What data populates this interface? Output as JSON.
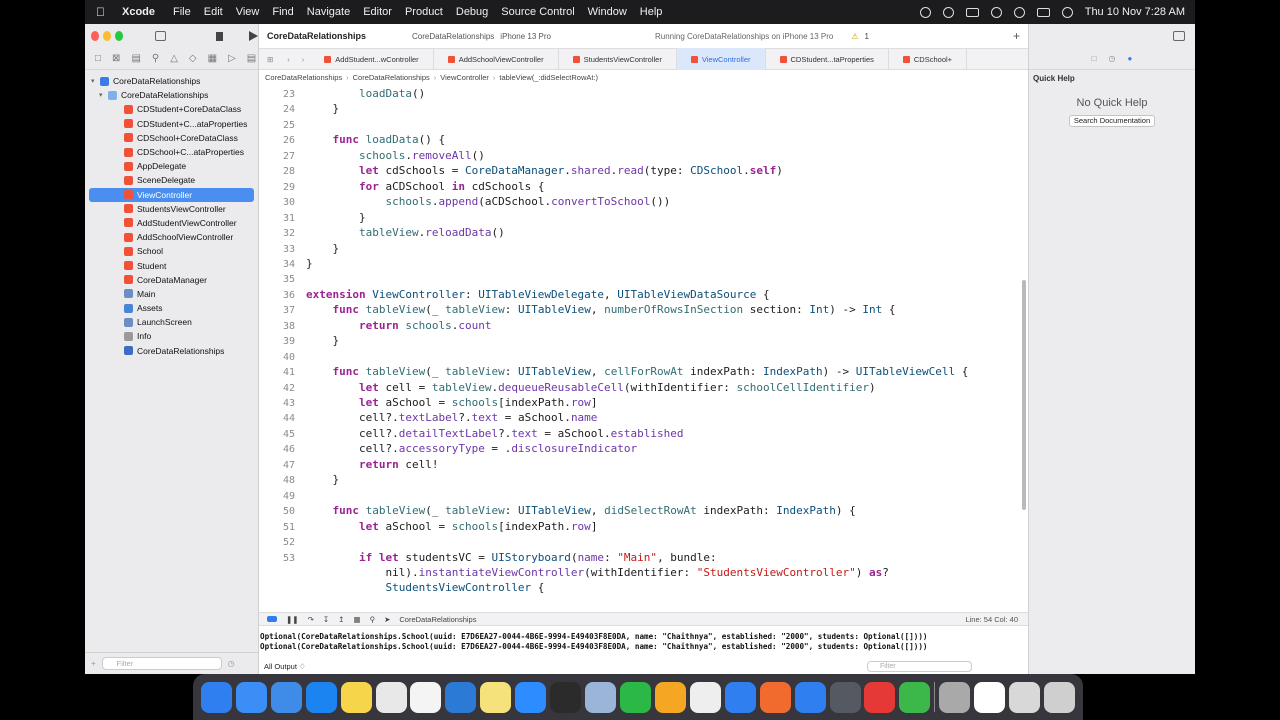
{
  "menubar": {
    "app_name": "Xcode",
    "menus": [
      "File",
      "Edit",
      "View",
      "Find",
      "Navigate",
      "Editor",
      "Product",
      "Debug",
      "Source Control",
      "Window",
      "Help"
    ],
    "datetime": "Thu 10 Nov  7:28 AM"
  },
  "toolbar": {
    "project_title": "CoreDataRelationships",
    "scheme": "CoreDataRelationships",
    "device": "iPhone 13 Pro",
    "status": "Running CoreDataRelationships on iPhone 13 Pro",
    "warning_count": "1"
  },
  "navigator": {
    "items": [
      {
        "label": "CoreDataRelationships",
        "icon": "project-icon"
      },
      {
        "label": "CoreDataRelationships",
        "icon": "folder-icon"
      },
      {
        "label": "CDStudent+CoreDataClass",
        "icon": "swift-file-icon"
      },
      {
        "label": "CDStudent+C...ataProperties",
        "icon": "swift-file-icon"
      },
      {
        "label": "CDSchool+CoreDataClass",
        "icon": "swift-file-icon"
      },
      {
        "label": "CDSchool+C...ataProperties",
        "icon": "swift-file-icon"
      },
      {
        "label": "AppDelegate",
        "icon": "swift-file-icon"
      },
      {
        "label": "SceneDelegate",
        "icon": "swift-file-icon"
      },
      {
        "label": "ViewController",
        "icon": "swift-file-icon"
      },
      {
        "label": "StudentsViewController",
        "icon": "swift-file-icon"
      },
      {
        "label": "AddStudentViewController",
        "icon": "swift-file-icon"
      },
      {
        "label": "AddSchoolViewController",
        "icon": "swift-file-icon"
      },
      {
        "label": "School",
        "icon": "swift-file-icon"
      },
      {
        "label": "Student",
        "icon": "swift-file-icon"
      },
      {
        "label": "CoreDataManager",
        "icon": "swift-file-icon"
      },
      {
        "label": "Main",
        "icon": "storyboard-icon"
      },
      {
        "label": "Assets",
        "icon": "assets-icon"
      },
      {
        "label": "LaunchScreen",
        "icon": "storyboard-icon"
      },
      {
        "label": "Info",
        "icon": "plist-icon"
      },
      {
        "label": "CoreDataRelationships",
        "icon": "data-model-icon"
      }
    ],
    "selected_index": 8,
    "filter_placeholder": "Filter"
  },
  "tabs": [
    {
      "label": "AddStudent...wController",
      "active": false
    },
    {
      "label": "AddSchoolViewController",
      "active": false
    },
    {
      "label": "StudentsViewController",
      "active": false
    },
    {
      "label": "ViewController",
      "active": true
    },
    {
      "label": "CDStudent...taProperties",
      "active": false
    },
    {
      "label": "CDSchool+",
      "active": false
    }
  ],
  "breadcrumb": [
    "CoreDataRelationships",
    "CoreDataRelationships",
    "ViewController",
    "tableView(_:didSelectRowAt:)"
  ],
  "code_lines": [
    {
      "n": "23",
      "t": "        loadData()"
    },
    {
      "n": "24",
      "t": "    }"
    },
    {
      "n": "25",
      "t": ""
    },
    {
      "n": "26",
      "t": "    func loadData() {"
    },
    {
      "n": "27",
      "t": "        schools.removeAll()"
    },
    {
      "n": "28",
      "t": "        let cdSchools = CoreDataManager.shared.read(type: CDSchool.self)"
    },
    {
      "n": "29",
      "t": "        for aCDSchool in cdSchools {"
    },
    {
      "n": "30",
      "t": "            schools.append(aCDSchool.convertToSchool())"
    },
    {
      "n": "31",
      "t": "        }"
    },
    {
      "n": "32",
      "t": "        tableView.reloadData()"
    },
    {
      "n": "33",
      "t": "    }"
    },
    {
      "n": "34",
      "t": "}"
    },
    {
      "n": "35",
      "t": ""
    },
    {
      "n": "36",
      "t": "extension ViewController: UITableViewDelegate, UITableViewDataSource {"
    },
    {
      "n": "37",
      "t": "    func tableView(_ tableView: UITableView, numberOfRowsInSection section: Int) -> Int {"
    },
    {
      "n": "38",
      "t": "        return schools.count"
    },
    {
      "n": "39",
      "t": "    }"
    },
    {
      "n": "40",
      "t": ""
    },
    {
      "n": "41",
      "t": "    func tableView(_ tableView: UITableView, cellForRowAt indexPath: IndexPath) -> UITableViewCell {"
    },
    {
      "n": "42",
      "t": "        let cell = tableView.dequeueReusableCell(withIdentifier: schoolCellIdentifier)"
    },
    {
      "n": "43",
      "t": "        let aSchool = schools[indexPath.row]"
    },
    {
      "n": "44",
      "t": "        cell?.textLabel?.text = aSchool.name"
    },
    {
      "n": "45",
      "t": "        cell?.detailTextLabel?.text = aSchool.established"
    },
    {
      "n": "46",
      "t": "        cell?.accessoryType = .disclosureIndicator"
    },
    {
      "n": "47",
      "t": "        return cell!"
    },
    {
      "n": "48",
      "t": "    }"
    },
    {
      "n": "49",
      "t": ""
    },
    {
      "n": "50",
      "t": "    func tableView(_ tableView: UITableView, didSelectRowAt indexPath: IndexPath) {"
    },
    {
      "n": "51",
      "t": "        let aSchool = schools[indexPath.row]"
    },
    {
      "n": "52",
      "t": ""
    },
    {
      "n": "53",
      "t": "        if let studentsVC = UIStoryboard(name: \"Main\", bundle:"
    },
    {
      "n": "",
      "t": "            nil).instantiateViewController(withIdentifier: \"StudentsViewController\") as?"
    },
    {
      "n": "",
      "t": "            StudentsViewController {"
    }
  ],
  "debug": {
    "target": "CoreDataRelationships",
    "cursor": "Line: 54  Col: 40",
    "console_lines": [
      "Optional(CoreDataRelationships.School(uuid: E7D6EA27-0044-4B6E-9994-E49403F8E0DA, name: \"Chaithnya\", established: \"2000\", students: Optional([])))",
      "Optional(CoreDataRelationships.School(uuid: E7D6EA27-0044-4B6E-9994-E49403F8E0DA, name: \"Chaithnya\", established: \"2000\", students: Optional([])))"
    ],
    "output_selector": "All Output ♢",
    "filter_placeholder": "Filter"
  },
  "inspector": {
    "title": "Quick Help",
    "empty_text": "No Quick Help",
    "search_button": "Search Documentation"
  },
  "dock": {
    "apps": [
      "finder-icon",
      "safari-icon",
      "xcode-icon",
      "app-store-icon",
      "notes-icon",
      "slack-icon",
      "chrome-icon",
      "vscode-icon",
      "stickies-icon",
      "zoom-icon",
      "terminal-icon",
      "preview-icon",
      "whatsapp-icon",
      "pages-icon",
      "textedit-icon",
      "keynote-icon",
      "swift-playgrounds-icon",
      "maps-icon",
      "screen-recorder-icon",
      "anydesk-icon",
      "numbers-icon",
      "printer-icon",
      "blank-doc-icon",
      "files-icon",
      "trash-icon"
    ],
    "colors": [
      "#2f7ff0",
      "#3a8ef5",
      "#3e8ce8",
      "#1c84f0",
      "#f7d54a",
      "#e8e8e8",
      "#f4f4f4",
      "#2a7ad6",
      "#f5e27a",
      "#2d8cff",
      "#2b2b2b",
      "#9ab5d8",
      "#2bb847",
      "#f5a623",
      "#eeeeee",
      "#2f7ff0",
      "#f26b2e",
      "#2f7ff0",
      "#555a62",
      "#e53935",
      "#3cb84a",
      "#a9a9a9",
      "#ffffff",
      "#d8d8d8",
      "#cfcfcf"
    ]
  },
  "colors": {
    "selection": "#4a8ef0",
    "keyword": "#9b2393",
    "type": "#0b4f79",
    "string": "#c41a16"
  }
}
